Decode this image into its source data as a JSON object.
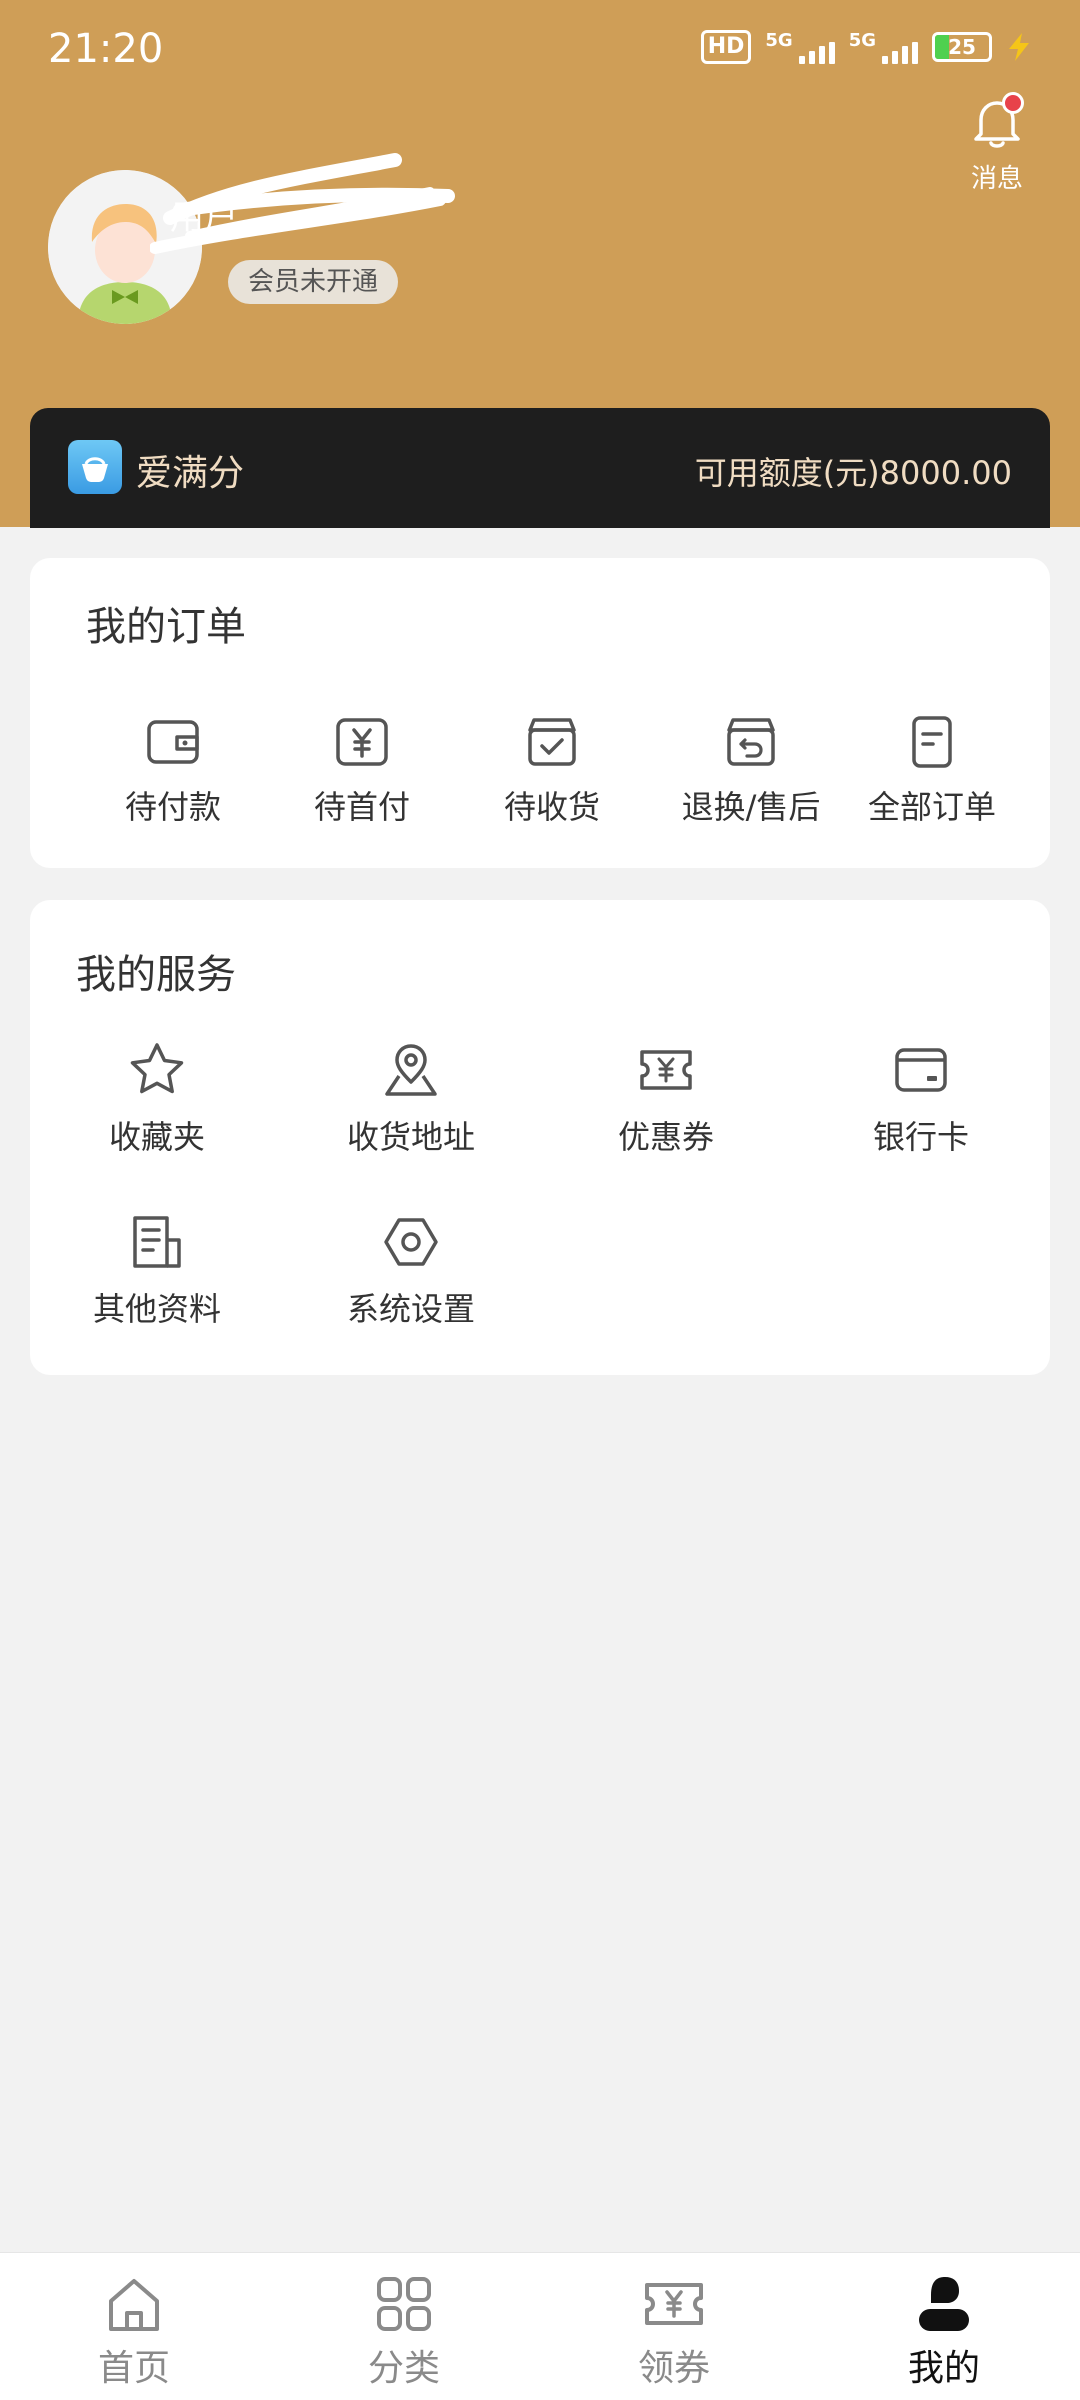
{
  "status_bar": {
    "time": "21:20",
    "hd_label": "HD",
    "signal1_label": "5G",
    "signal2_label": "5G",
    "battery_level": "25"
  },
  "header": {
    "message_label": "消息",
    "member_status": "会员未开通",
    "username": "用户"
  },
  "credit": {
    "product_name": "爱满分",
    "available_credit": "可用额度(元)8000.00"
  },
  "orders": {
    "title": "我的订单",
    "items": [
      {
        "label": "待付款",
        "icon": "wallet-icon"
      },
      {
        "label": "待首付",
        "icon": "yuan-icon"
      },
      {
        "label": "待收货",
        "icon": "receive-box-icon"
      },
      {
        "label": "退换/售后",
        "icon": "return-box-icon"
      },
      {
        "label": "全部订单",
        "icon": "document-icon"
      }
    ]
  },
  "services": {
    "title": "我的服务",
    "items": [
      {
        "label": "收藏夹",
        "icon": "star-icon"
      },
      {
        "label": "收货地址",
        "icon": "location-icon"
      },
      {
        "label": "优惠券",
        "icon": "coupon-icon"
      },
      {
        "label": "银行卡",
        "icon": "bank-card-icon"
      },
      {
        "label": "其他资料",
        "icon": "file-icon"
      },
      {
        "label": "系统设置",
        "icon": "settings-icon"
      }
    ]
  },
  "tabs": [
    {
      "label": "首页",
      "icon": "home-icon"
    },
    {
      "label": "分类",
      "icon": "category-icon"
    },
    {
      "label": "领券",
      "icon": "coupon-icon"
    },
    {
      "label": "我的",
      "icon": "user-icon",
      "active": true
    }
  ],
  "colors": {
    "header_bg": "#cf9e57",
    "credit_card_bg": "#1e1e1e",
    "credit_text": "#f0dcc2",
    "badge_red": "#e8424a",
    "active_tab": "#111111",
    "inactive_tab": "#8a8a8a"
  }
}
